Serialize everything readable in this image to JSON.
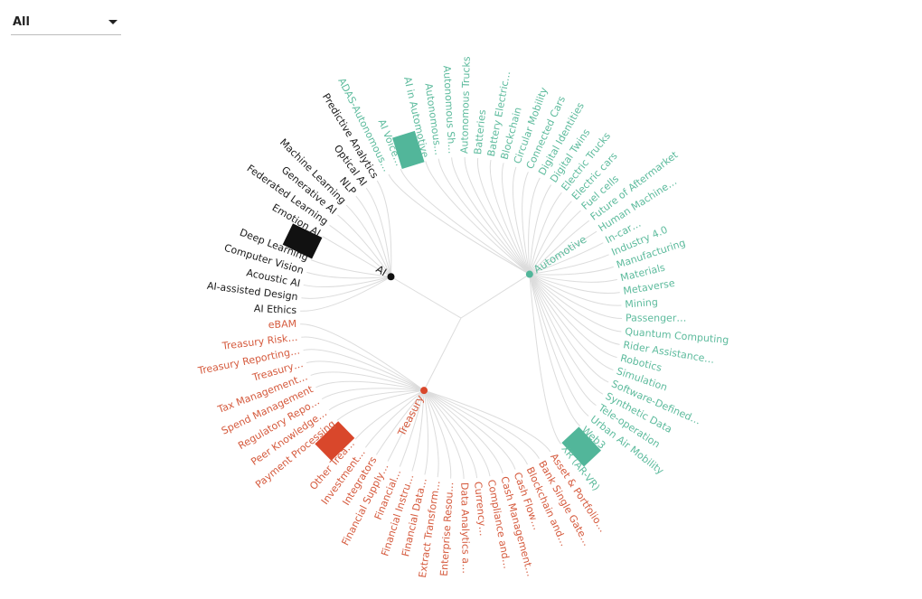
{
  "filter": {
    "selected": "All"
  },
  "chart_data": {
    "type": "radial-tree",
    "root": "",
    "colors": {
      "AI": "#111111",
      "Automotive": "#52b69a",
      "Treasury": "#d9472b"
    },
    "label_colors": {
      "AI": "#1a1a1a",
      "Automotive": "#5dbb9d",
      "Treasury": "#d55a3d"
    },
    "groups": [
      {
        "name": "AI",
        "children": [
          "AI Ethics",
          "AI-assisted Design",
          "Acoustic AI",
          "Computer Vision",
          "Deep Learning",
          "#marker",
          "Emotion AI",
          "Federated Learning",
          "Generative AI",
          "Machine Learning",
          "NLP",
          "Optical AI",
          "Predictive Analytics"
        ]
      },
      {
        "name": "Automotive",
        "children": [
          "ADAS-Autonomous…",
          "AI Voice…",
          "#marker",
          "AI in Automotive",
          "Autonomous…",
          "Autonomous Sh…",
          "Autonomous Trucks",
          "Batteries",
          "Battery Electric…",
          "Blockchain",
          "Circular Mobility",
          "Connected Cars",
          "Digital Identities",
          "Digital Twins",
          "Electric Trucks",
          "Electric cars",
          "Fuel cells",
          "Future of Aftermarket",
          "Human Machine…",
          "In-car…",
          "Industry 4.0",
          "Manufacturing",
          "Materials",
          "Metaverse",
          "Mining",
          "Passenger…",
          "Quantum Computing",
          "Rider Assistance…",
          "Robotics",
          "Simulation",
          "Software-Defined…",
          "Synthetic Data",
          "Tele-operation",
          "Urban Air Mobility",
          "Web3",
          "#marker",
          "XR (AR-VR)"
        ]
      },
      {
        "name": "Treasury",
        "children": [
          "Asset & Portfolio…",
          "Bank Single Gate…",
          "Blockchain and…",
          "Cash Flow…",
          "Cash Management…",
          "Compliance and…",
          "Currency…",
          "Data Analytics a…",
          "Enterprise Resou…",
          "Extract Transform…",
          "Financial Data…",
          "Financial Instru…",
          "Financial…",
          "Financial Supply…",
          "Integrators",
          "Investment…",
          "Other Trea…",
          "#marker",
          "Payment Processing",
          "Peer Knowledge…",
          "Regulatory Repo…",
          "Spend Management",
          "Tax Management…",
          "Treasury…",
          "Treasury Reporting…",
          "Treasury Risk…",
          "eBAM"
        ]
      }
    ]
  }
}
